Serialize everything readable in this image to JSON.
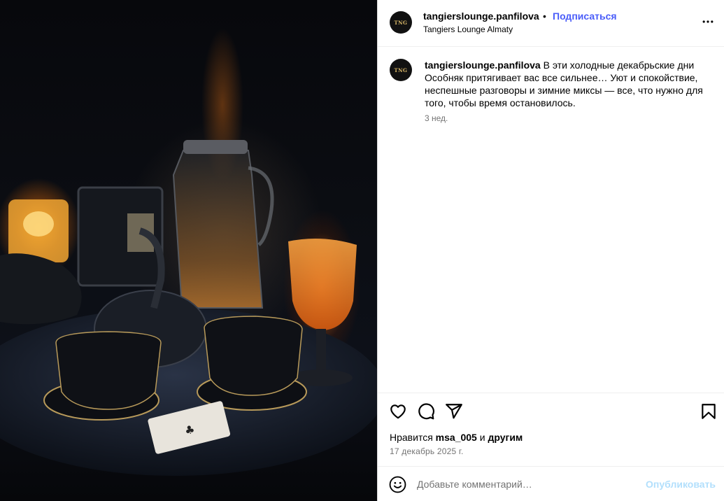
{
  "post": {
    "username": "tangierslounge.panfilova",
    "separator": "•",
    "follow_label": "Подписаться",
    "location": "Tangiers Lounge Almaty",
    "avatar_text": "TNG",
    "caption_text": "В эти холодные декабрьские дни Особняк притягивает вас все сильнее… Уют и спокойствие, неспешные разговоры и зимние миксы — все, что нужно для того, чтобы время остановилось.",
    "caption_time": "3 нед.",
    "likes_prefix": "Нравится",
    "likes_user": "msa_005",
    "likes_middle": "и",
    "likes_others": "другим",
    "date": "17 декабрь 2025 г."
  },
  "comment": {
    "placeholder": "Добавьте комментарий…",
    "publish_label": "Опубликовать"
  },
  "icons": {
    "more": "more-options-icon",
    "like": "heart-icon",
    "comment": "comment-icon",
    "share": "share-icon",
    "save": "bookmark-icon",
    "emoji": "emoji-icon"
  },
  "colors": {
    "follow": "#4a5df9",
    "publish_disabled": "#b2dffc",
    "muted_text": "#737373"
  }
}
